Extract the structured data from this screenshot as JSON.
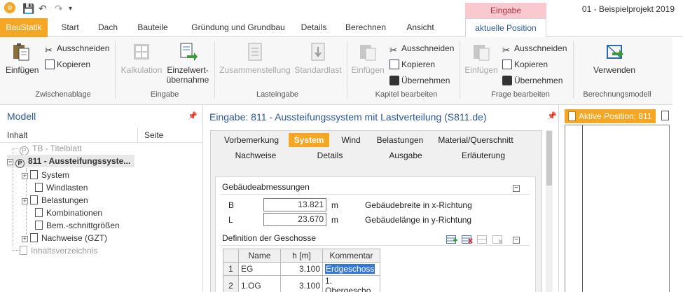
{
  "titlebar": {
    "window_title": "01 - Beispielprojekt 2019",
    "context_group": "Eingabe"
  },
  "tabs": {
    "baustatik": "BauStatik",
    "start": "Start",
    "dach": "Dach",
    "bauteile": "Bauteile",
    "gruendung": "Gründung und Grundbau",
    "details": "Details",
    "berechnen": "Berechnen",
    "ansicht": "Ansicht",
    "aktuelle": "aktuelle Position"
  },
  "ribbon": {
    "zwischenablage": {
      "group": "Zwischenablage",
      "einfuegen": "Einfügen",
      "ausschneiden": "Ausschneiden",
      "kopieren": "Kopieren"
    },
    "eingabe": {
      "group": "Eingabe",
      "kalkulation": "Kalkulation",
      "einzelwert1": "Einzelwert-",
      "einzelwert2": "übernahme"
    },
    "lasteingabe": {
      "group": "Lasteingabe",
      "zusammenstellung": "Zusammenstellung",
      "standardlast": "Standardlast"
    },
    "kapitel": {
      "group": "Kapitel bearbeiten",
      "einfuegen": "Einfügen",
      "ausschneiden": "Ausschneiden",
      "kopieren": "Kopieren",
      "uebernehmen": "Übernehmen"
    },
    "frage": {
      "group": "Frage bearbeiten",
      "einfuegen": "Einfügen",
      "ausschneiden": "Ausschneiden",
      "kopieren": "Kopieren",
      "uebernehmen": "Übernehmen"
    },
    "berechnungsmodell": {
      "group": "Berechnungsmodell",
      "verwenden": "Verwenden"
    }
  },
  "modell": {
    "title": "Modell",
    "col_inhalt": "Inhalt",
    "col_seite": "Seite",
    "tree": {
      "tb": "TB - Titelblatt",
      "pos811": "811 - Aussteifungssyste...",
      "system": "System",
      "windlasten": "Windlasten",
      "belastungen": "Belastungen",
      "kombinationen": "Kombinationen",
      "bem": "Bem.-schnittgrößen",
      "nachweise": "Nachweise (GZT)",
      "inhaltsverzeichnis": "Inhaltsverzeichnis"
    }
  },
  "eingabe": {
    "title": "Eingabe: 811 - Aussteifungssystem mit Lastverteilung (S811.de)",
    "tabs": {
      "vorbemerkung": "Vorbemerkung",
      "system": "System",
      "wind": "Wind",
      "belastungen": "Belastungen",
      "material": "Material/Querschnitt",
      "nachweise": "Nachweise",
      "details": "Details",
      "ausgabe": "Ausgabe",
      "erlaeuterung": "Erläuterung"
    },
    "gebaeude": {
      "heading": "Gebäudeabmessungen",
      "b_label": "B",
      "b_value": "13.821",
      "b_unit": "m",
      "b_desc": "Gebäudebreite in x-Richtung",
      "l_label": "L",
      "l_value": "23.670",
      "l_unit": "m",
      "l_desc": "Gebäudelänge in y-Richtung"
    },
    "geschosse": {
      "heading": "Definition der Geschosse",
      "col_name": "Name",
      "col_h": "h [m]",
      "col_kommentar": "Kommentar",
      "rows": [
        {
          "nr": "1",
          "name": "EG",
          "h": "3.100",
          "kommentar": "Erdgeschoss"
        },
        {
          "nr": "2",
          "name": "1.OG",
          "h": "3.100",
          "kommentar": "1. Obergescho"
        }
      ]
    }
  },
  "rightpanel": {
    "active_position": "Aktive Position: 811"
  }
}
